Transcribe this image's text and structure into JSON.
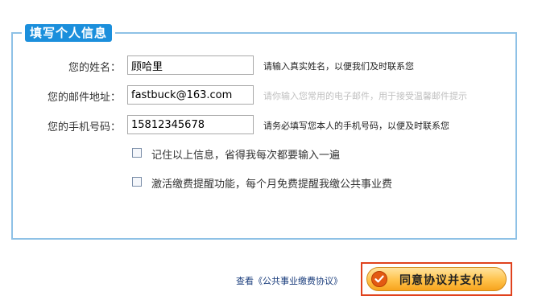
{
  "section": {
    "title": "填写个人信息"
  },
  "fields": [
    {
      "label": "您的姓名：",
      "value": "顾哈里",
      "hint": "请输入真实姓名，以便我们及时联系您"
    },
    {
      "label": "您的邮件地址：",
      "value": "fastbuck@163.com",
      "hint": "请你输入您常用的电子邮件，用于接受温馨邮件提示"
    },
    {
      "label": "您的手机号码：",
      "value": "15812345678",
      "hint": "请务必填写您本人的手机号码，以便及时联系您"
    }
  ],
  "options": [
    {
      "label": "记住以上信息，省得我每次都要输入一遍",
      "checked": false
    },
    {
      "label": "激活缴费提醒功能，每个月免费提醒我缴公共事业费",
      "checked": false
    }
  ],
  "footer": {
    "agreement_link": "查看《公共事业缴费协议》",
    "submit_label": "同意协议并支付"
  },
  "colors": {
    "accent": "#1b8fdc",
    "border": "#8ec1e6",
    "button": "#ffc24a",
    "highlight": "#e0421d"
  }
}
